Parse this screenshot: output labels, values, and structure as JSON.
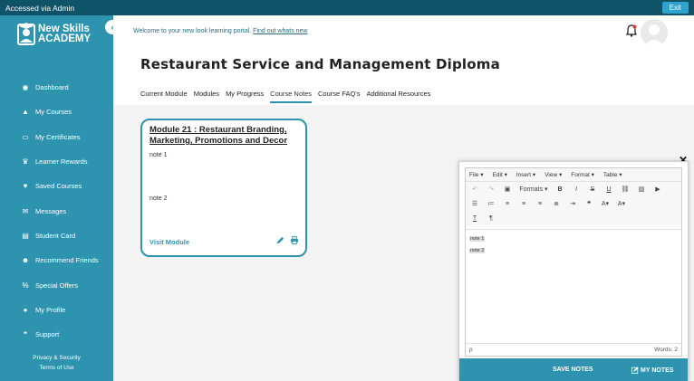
{
  "topbar": {
    "accessed_text": "Accessed via Admin",
    "exit_label": "Exit"
  },
  "sidebar": {
    "logo_line1": "New Skills",
    "logo_line2": "ACADEMY",
    "items": [
      {
        "label": "Dashboard",
        "icon": "dashboard-icon"
      },
      {
        "label": "My Courses",
        "icon": "graduation-cap-icon"
      },
      {
        "label": "My Certificates",
        "icon": "laptop-icon"
      },
      {
        "label": "Learner Rewards",
        "icon": "trophy-icon"
      },
      {
        "label": "Saved Courses",
        "icon": "heart-icon"
      },
      {
        "label": "Messages",
        "icon": "envelope-icon"
      },
      {
        "label": "Student Card",
        "icon": "id-card-icon"
      },
      {
        "label": "Recommend Friends",
        "icon": "users-icon"
      },
      {
        "label": "Special Offers",
        "icon": "percent-icon"
      },
      {
        "label": "My Profile",
        "icon": "user-icon"
      },
      {
        "label": "Support",
        "icon": "chat-icon"
      }
    ],
    "footer_privacy": "Privacy & Security",
    "footer_terms": "Terms of Use"
  },
  "header": {
    "welcome_text": "Welcome to your new look learning portal. ",
    "welcome_link": "Find out whats new"
  },
  "page": {
    "title": "Restaurant Service and Management Diploma",
    "tabs": [
      "Current Module",
      "Modules",
      "My Progress",
      "Course Notes",
      "Course FAQ's",
      "Additional Resources"
    ],
    "active_tab": "Course Notes"
  },
  "card": {
    "title": "Module 21 : Restaurant Branding, Marketing, Promotions and Decor",
    "notes": [
      "note 1",
      "note 2"
    ],
    "visit_label": "Visit Module"
  },
  "editor": {
    "menus": [
      "File",
      "Edit",
      "Insert",
      "View",
      "Format",
      "Table"
    ],
    "formats_label": "Formats",
    "content_lines": [
      "note 1",
      "note 2"
    ],
    "status_path": "p",
    "word_count": "Words: 2",
    "save_label": "SAVE NOTES",
    "mynotes_label": "MY NOTES"
  },
  "colors": {
    "primary": "#2d93ae",
    "topbar": "#0f5368",
    "exit": "#2fa3cd"
  }
}
